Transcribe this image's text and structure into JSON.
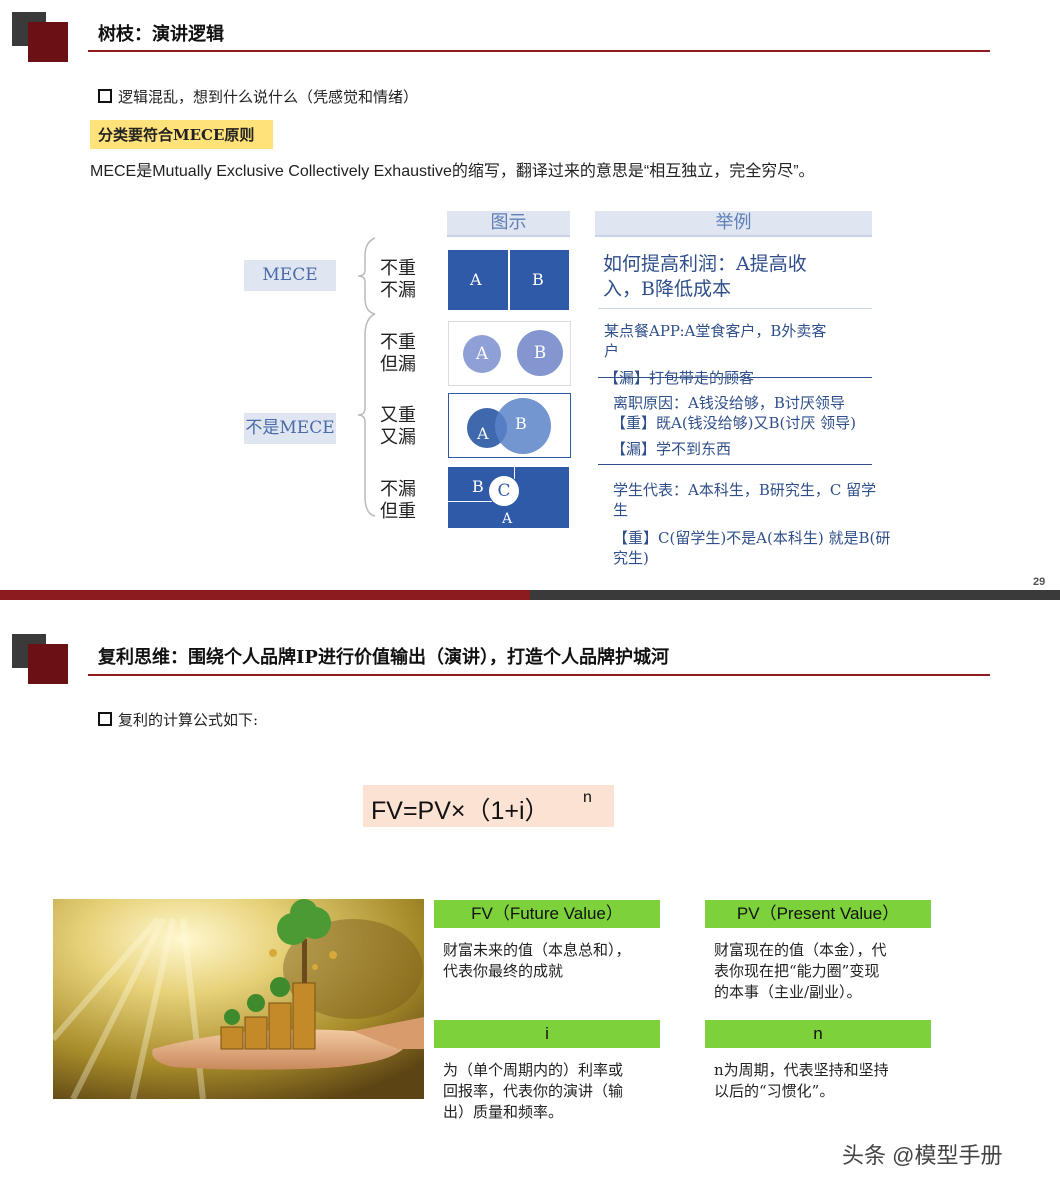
{
  "slide1": {
    "title": "树枝：演讲逻辑",
    "bullet": "逻辑混乱，想到什么说什么（凭感觉和情绪）",
    "highlight": "分类要符合MECE原则",
    "definition": "MECE是Mutually Exclusive Collectively Exhaustive的缩写，翻译过来的意思是“相互独立，完全穷尽”。",
    "col_headers": {
      "diagram": "图示",
      "example": "举例"
    },
    "tags": {
      "mece": "MECE",
      "not_mece": "不是MECE"
    },
    "rows": [
      {
        "label": [
          "不重",
          "不漏"
        ],
        "circles": [
          "A",
          "B"
        ],
        "example": [
          "如何提高利润：A提高收",
          "入，B降低成本"
        ]
      },
      {
        "label": [
          "不重",
          "但漏"
        ],
        "circles": [
          "A",
          "B"
        ],
        "example": [
          "某点餐APP:A堂食客户，B外卖客",
          "户",
          "【漏】打包带走的顾客"
        ]
      },
      {
        "label": [
          "又重",
          "又漏"
        ],
        "circles": [
          "A",
          "B"
        ],
        "example": [
          "离职原因：A钱没给够，B讨厌领导",
          "【重】既A(钱没给够)又B(讨厌 领导)",
          "【漏】学不到东西"
        ]
      },
      {
        "label": [
          "不漏",
          "但重"
        ],
        "circles": [
          "B",
          "C",
          "A"
        ],
        "example": [
          "学生代表：A本科生，B研究生，C 留学",
          "生",
          "【重】C(留学生)不是A(本科生) 就是B(研",
          "究生)"
        ]
      }
    ],
    "page_number": "29"
  },
  "slide2": {
    "title": "复利思维：围绕个人品牌IP进行价值输出（演讲），打造个人品牌护城河",
    "bullet": "复利的计算公式如下:",
    "formula": "FV=PV×（1+i）",
    "formula_exp": "n",
    "cards": [
      {
        "head": "FV（Future Value）",
        "body": [
          "财富未来的值（本息总和），",
          "代表你最终的成就"
        ]
      },
      {
        "head": "PV（Present Value）",
        "body": [
          "财富现在的值（本金），代",
          "表你现在把“能力圈”变现",
          "的本事（主业/副业）。"
        ]
      },
      {
        "head": "i",
        "body": [
          "为（单个周期内的）利率或",
          "回报率，代表你的演讲（输",
          "出）质量和频率。"
        ]
      },
      {
        "head": "n",
        "body": [
          "n为周期，代表坚持和坚持",
          "以后的“习惯化”。"
        ]
      }
    ]
  },
  "watermark": "头条 @模型手册",
  "colors": {
    "brand_red": "#6b1014",
    "rule_red": "#8c1b1f",
    "box_blue": "#2f5aa8",
    "circle_blue": "#8fa0d6",
    "green": "#7dd13a",
    "formula_bg": "#fbe2d3"
  }
}
